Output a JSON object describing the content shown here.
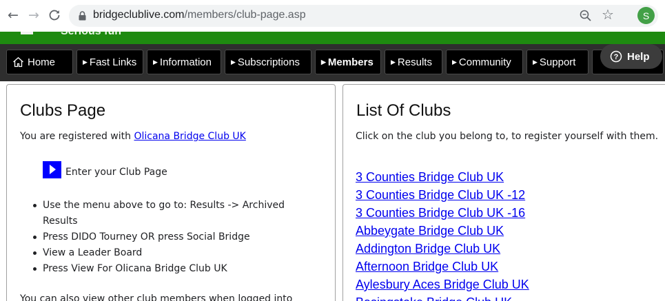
{
  "browser": {
    "url_domain": "bridgeclublive.com",
    "url_path": "/members/club-page.asp",
    "profile_initial": "S"
  },
  "site": {
    "header_title": "Serious fun",
    "nav": {
      "home": "Home",
      "fast_links": "Fast Links",
      "information": "Information",
      "subscriptions": "Subscriptions",
      "members": "Members",
      "results": "Results",
      "community": "Community",
      "support": "Support",
      "help": "Help"
    }
  },
  "left_panel": {
    "title": "Clubs Page",
    "registered_prefix": "You are registered with ",
    "registered_club": "Olicana Bridge Club UK",
    "enter_label": "Enter your Club Page",
    "bullets": [
      "Use the menu above to go to: Results -> Archived Results",
      "Press DIDO Tourney OR press Social Bridge",
      "View a Leader Board",
      "Press View For Olicana Bridge Club UK"
    ],
    "bottom_text": "You can also view other club members when logged into"
  },
  "right_panel": {
    "title": "List Of Clubs",
    "intro": "Click on the club you belong to, to register yourself with them.",
    "clubs": [
      "3 Counties Bridge Club UK",
      "3 Counties Bridge Club UK -12",
      "3 Counties Bridge Club UK -16",
      "Abbeygate Bridge Club UK",
      "Addington Bridge Club UK",
      "Afternoon Bridge Club UK",
      "Aylesbury Aces Bridge Club UK",
      "Basingstoke Bridge Club UK"
    ]
  },
  "colors": {
    "header_green": "#1e8a10",
    "nav_bg": "#2e2e2e",
    "link": "#0000ee",
    "enter_icon": "#0000ff"
  }
}
